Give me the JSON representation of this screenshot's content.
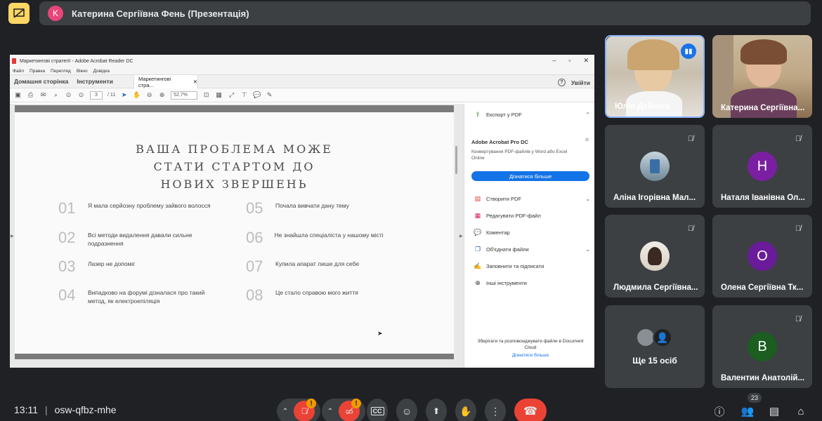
{
  "meet": {
    "presenter_initial": "K",
    "presenter_banner": "Катерина Сергіївна Фень (Презентація)",
    "time": "13:11",
    "meeting_code": "osw-qfbz-mhe",
    "participant_count": "23",
    "more_people_label": "Ще 15 осіб"
  },
  "acrobat": {
    "window_title": "Маркетингові стратегії - Adobe Acrobat Reader DC",
    "menu": [
      "Файл",
      "Правка",
      "Перегляд",
      "Вікно",
      "Довідка"
    ],
    "tab_home": "Домашня сторінка",
    "tab_tools": "Інструменти",
    "doc_tab": "Маркетингові стра...",
    "sign_in": "Увійти",
    "page_current": "3",
    "page_total": "/ 11",
    "zoom": "52,7%"
  },
  "slide": {
    "title": "ВАША ПРОБЛЕМА МОЖЕ\nСТАТИ СТАРТОМ ДО\nНОВИХ ЗВЕРШЕНЬ",
    "items": [
      {
        "num": "01",
        "text": "Я мала серйозну проблему зайвого волосся"
      },
      {
        "num": "02",
        "text": "Всі методи видалення давали сильне подразнення"
      },
      {
        "num": "03",
        "text": "Лазер не допоміг"
      },
      {
        "num": "04",
        "text": "Випадково на форумі дізналася про такий метод, як електроепіляція"
      },
      {
        "num": "05",
        "text": "Почала вивчати дану тему"
      },
      {
        "num": "06",
        "text": "Не знайшла спеціаліста у нашому місті"
      },
      {
        "num": "07",
        "text": "Купила апарат лише для себе"
      },
      {
        "num": "08",
        "text": "Це стало справою мого життя"
      }
    ]
  },
  "right_panel": {
    "export_pdf": "Експорт у PDF",
    "pro_title": "Adobe Acrobat Pro DC",
    "pro_desc": "Конвертування PDF-файлів у Word або Excel Online",
    "learn_more": "Дізнатися більше",
    "tools": [
      "Створити PDF",
      "Редагувати PDF-файл",
      "Коментар",
      "Об'єднати файли",
      "Заповнити та підписати",
      "Інші інструменти"
    ],
    "cloud_text": "Зберігати та розповсюджувати файли в Document Cloud",
    "cloud_link": "Дізнатися більше"
  },
  "participants": [
    {
      "name": "Юлія Дейнега"
    },
    {
      "name": "Катерина Сергіївна..."
    },
    {
      "name": "Аліна Ігорівна Мал..."
    },
    {
      "name": "Наталя Іванівна Ол...",
      "initial": "Н",
      "color": "#7b1fa2"
    },
    {
      "name": "Людмила Сергіївна..."
    },
    {
      "name": "Олена Сергіївна Тк...",
      "initial": "О",
      "color": "#6a1b9a"
    },
    {
      "name": "Валентин Анатолій...",
      "initial": "В",
      "color": "#1b5e20"
    }
  ]
}
